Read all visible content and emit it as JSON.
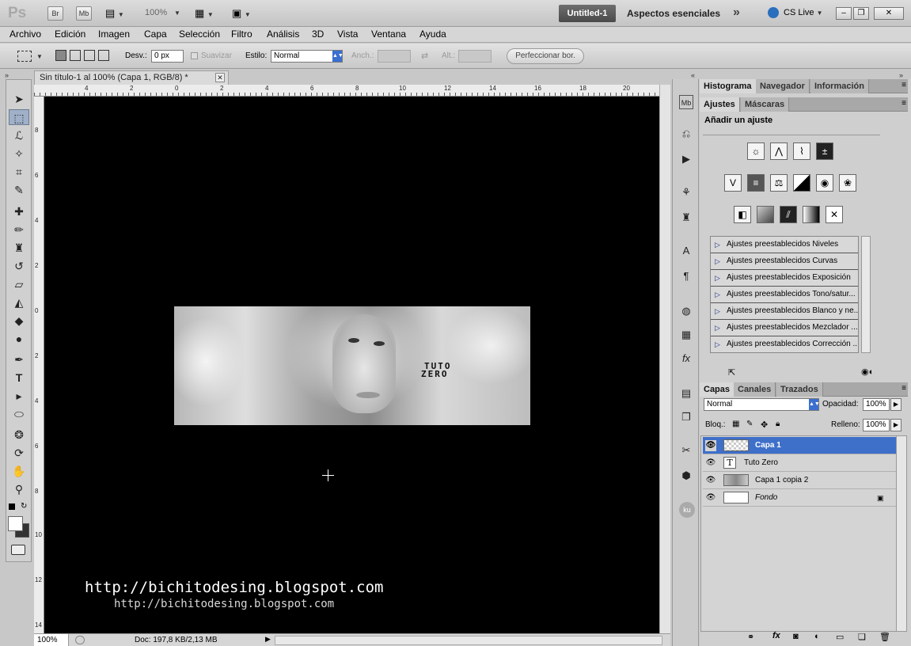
{
  "appbar": {
    "logo": "Ps",
    "bridge": "Br",
    "minibridge": "Mb",
    "zoom": "100%",
    "document_title": "Untitled-1",
    "workspace": "Aspectos esenciales",
    "more": "»",
    "cs_live": "CS Live",
    "minimize": "–",
    "restore": "❐",
    "close": "✕"
  },
  "menu": [
    "Archivo",
    "Edición",
    "Imagen",
    "Capa",
    "Selección",
    "Filtro",
    "Análisis",
    "3D",
    "Vista",
    "Ventana",
    "Ayuda"
  ],
  "options": {
    "feather_label": "Desv.:",
    "feather_value": "0 px",
    "antialias_label": "Suavizar",
    "style_label": "Estilo:",
    "style_value": "Normal",
    "width_label": "Anch.:",
    "height_label": "Alt.:",
    "refine_button": "Perfeccionar bor."
  },
  "document": {
    "tab_title": "Sin título-1 al 100% (Capa 1, RGB/8) *",
    "tab_close": "✕",
    "ruler_h_labels": [
      "4",
      "2",
      "0",
      "2",
      "4",
      "6",
      "8",
      "10",
      "12",
      "14",
      "16",
      "18",
      "20"
    ],
    "ruler_v_labels": [
      "8",
      "6",
      "4",
      "2",
      "0",
      "2",
      "4",
      "6",
      "8",
      "10",
      "12",
      "14"
    ],
    "banner_text_line1": "TUTO",
    "banner_text_line2": "ZERO",
    "watermark_large": "http://bichitodesing.blogspot.com",
    "watermark_small": "http://bichitodesing.blogspot.com"
  },
  "status": {
    "zoom": "100%",
    "doc_info": "Doc: 197,8 KB/2,13 MB"
  },
  "panels": {
    "top_tabs": [
      "Histograma",
      "Navegador",
      "Información"
    ],
    "adj_tabs": [
      "Ajustes",
      "Máscaras"
    ],
    "add_adjustment": "Añadir un ajuste",
    "presets": [
      "Ajustes preestablecidos Niveles",
      "Ajustes preestablecidos Curvas",
      "Ajustes preestablecidos Exposición",
      "Ajustes preestablecidos Tono/satur...",
      "Ajustes preestablecidos Blanco y ne...",
      "Ajustes preestablecidos Mezclador ...",
      "Ajustes preestablecidos Corrección ..."
    ],
    "layers_tabs": [
      "Capas",
      "Canales",
      "Trazados"
    ],
    "blend_mode": "Normal",
    "opacity_label": "Opacidad:",
    "opacity_value": "100%",
    "lock_label": "Bloq.:",
    "fill_label": "Relleno:",
    "fill_value": "100%",
    "layers": [
      {
        "name": "Capa 1",
        "active": true
      },
      {
        "name": "Tuto Zero",
        "active": false
      },
      {
        "name": "Capa 1 copia 2",
        "active": false
      },
      {
        "name": "Fondo",
        "active": false
      }
    ]
  }
}
